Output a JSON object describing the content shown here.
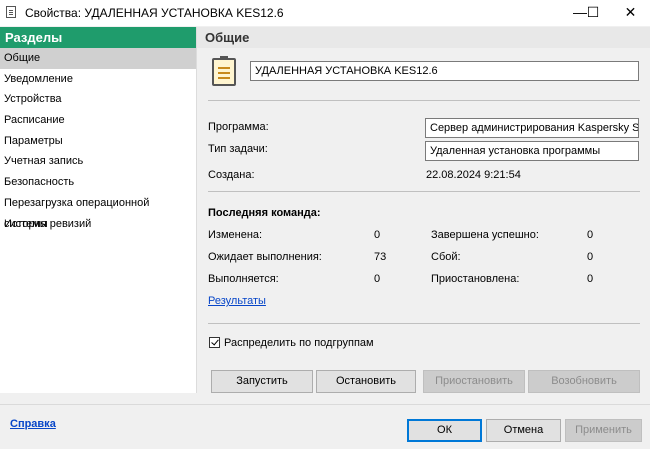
{
  "window": {
    "title": "Свойства: УДАЛЕННАЯ УСТАНОВКА KES12.6",
    "minimize_glyph": "—",
    "maximize_glyph": "☐",
    "close_glyph": "✕"
  },
  "sidebar": {
    "header": "Разделы",
    "items": [
      {
        "label": "Общие",
        "selected": true
      },
      {
        "label": "Уведомление"
      },
      {
        "label": "Устройства"
      },
      {
        "label": "Расписание"
      },
      {
        "label": "Параметры"
      },
      {
        "label": "Учетная запись"
      },
      {
        "label": "Безопасность"
      },
      {
        "label": "Перезагрузка операционной системы"
      },
      {
        "label": "История ревизий"
      }
    ]
  },
  "main": {
    "header": "Общие",
    "task_name": "УДАЛЕННАЯ УСТАНОВКА KES12.6",
    "program_label": "Программа:",
    "program_value": "Сервер администрирования Kaspersky Security",
    "task_type_label": "Тип задачи:",
    "task_type_value": "Удаленная установка программы",
    "created_label": "Создана:",
    "created_value": "22.08.2024 9:21:54",
    "last_command_label": "Последняя команда:",
    "stats": {
      "changed_label": "Изменена:",
      "changed_value": "0",
      "waiting_label": "Ожидает выполнения:",
      "waiting_value": "73",
      "running_label": "Выполняется:",
      "running_value": "0",
      "completed_label": "Завершена успешно:",
      "completed_value": "0",
      "failed_label": "Сбой:",
      "failed_value": "0",
      "paused_label": "Приостановлена:",
      "paused_value": "0"
    },
    "results_link": "Результаты",
    "distribute_checkbox_label": "Распределить по подгруппам",
    "distribute_checked": true,
    "buttons": {
      "start": "Запустить",
      "stop": "Остановить",
      "pause": "Приостановить",
      "resume": "Возобновить"
    }
  },
  "footer": {
    "help_link": "Справка",
    "ok": "ОК",
    "cancel": "Отмена",
    "apply": "Применить"
  },
  "colors": {
    "sidebar_header_bg": "#1f9c6c",
    "link": "#0645c8",
    "default_button_border": "#0078d7"
  }
}
